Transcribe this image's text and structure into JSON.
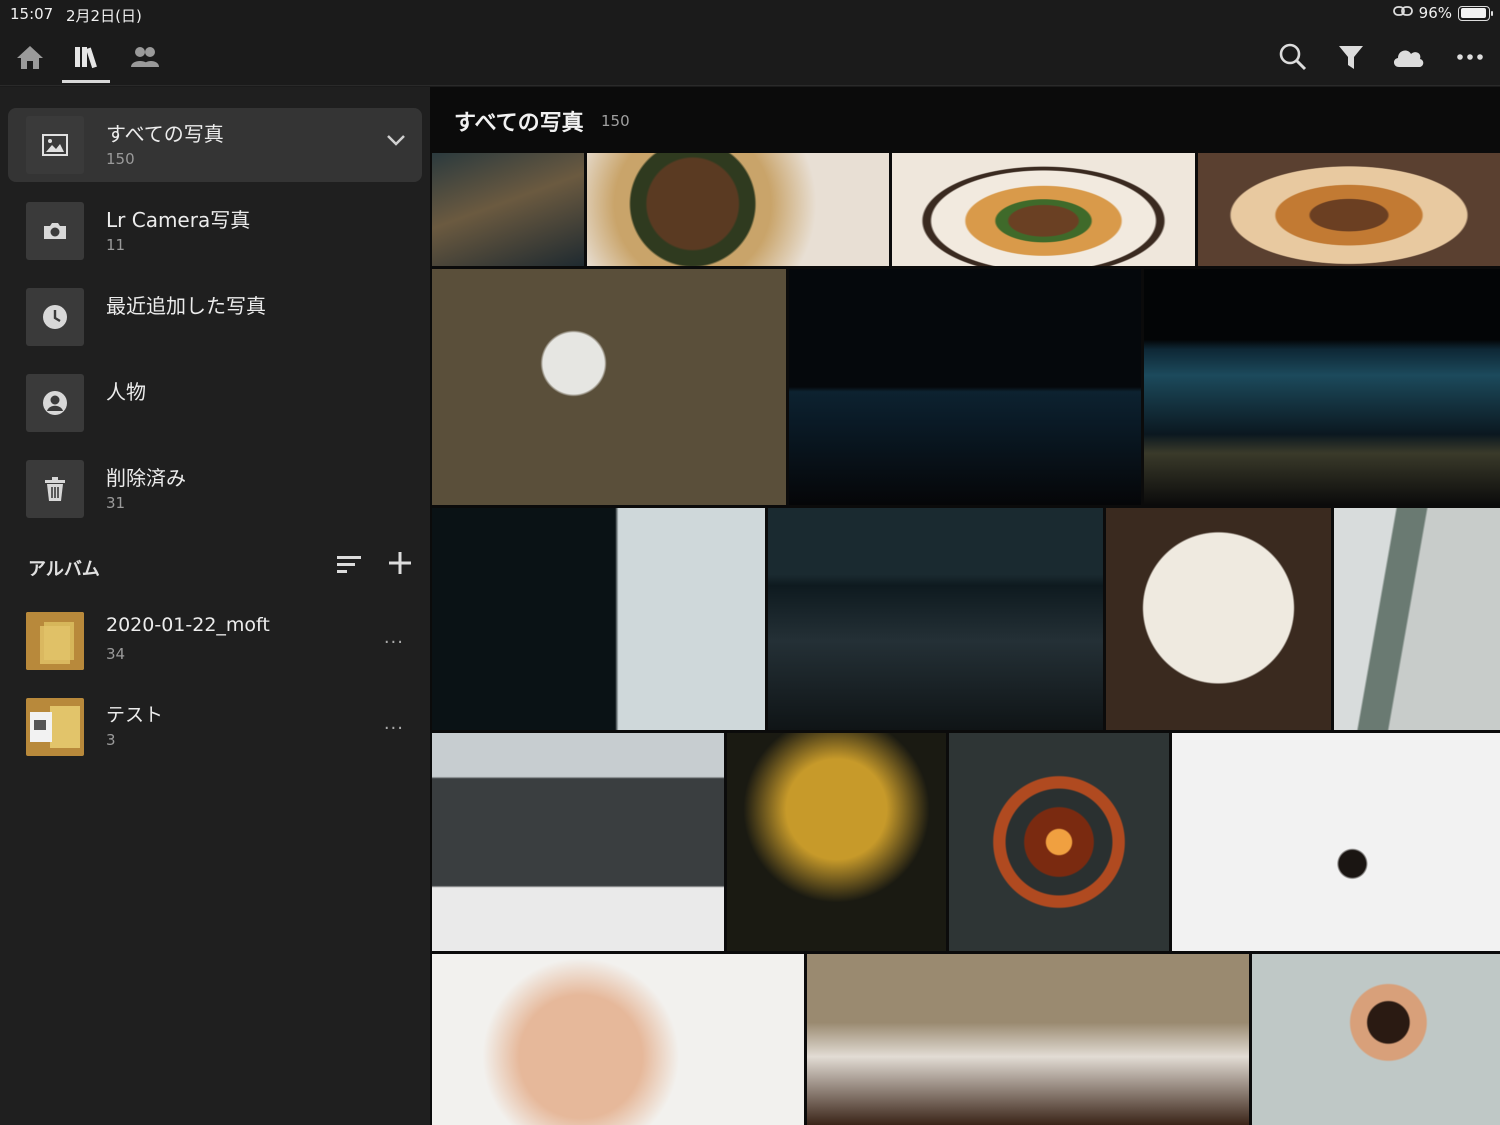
{
  "status_bar": {
    "time": "15:07",
    "date": "2月2日(日)",
    "battery": "96%",
    "battery_level": 0.96
  },
  "toolbar": {
    "left_icons": [
      "home-icon",
      "library-icon",
      "people-icon"
    ],
    "right_icons": [
      "search-icon",
      "filter-icon",
      "cloud-icon",
      "more-icon"
    ]
  },
  "sidebar": {
    "items": [
      {
        "title": "すべての写真",
        "count": "150",
        "icon": "photo-icon"
      },
      {
        "title": "Lr Camera写真",
        "count": "11",
        "icon": "camera-icon"
      },
      {
        "title": "最近追加した写真",
        "count": "",
        "icon": "clock-icon"
      },
      {
        "title": "人物",
        "count": "",
        "icon": "person-icon"
      },
      {
        "title": "削除済み",
        "count": "31",
        "icon": "trash-icon"
      }
    ],
    "albums_label": "アルバム",
    "albums": [
      {
        "title": "2020-01-22_moft",
        "count": "34",
        "more": "···"
      },
      {
        "title": "テスト",
        "count": "3",
        "more": "···"
      }
    ]
  },
  "main": {
    "title": "すべての写真",
    "count": "150"
  }
}
